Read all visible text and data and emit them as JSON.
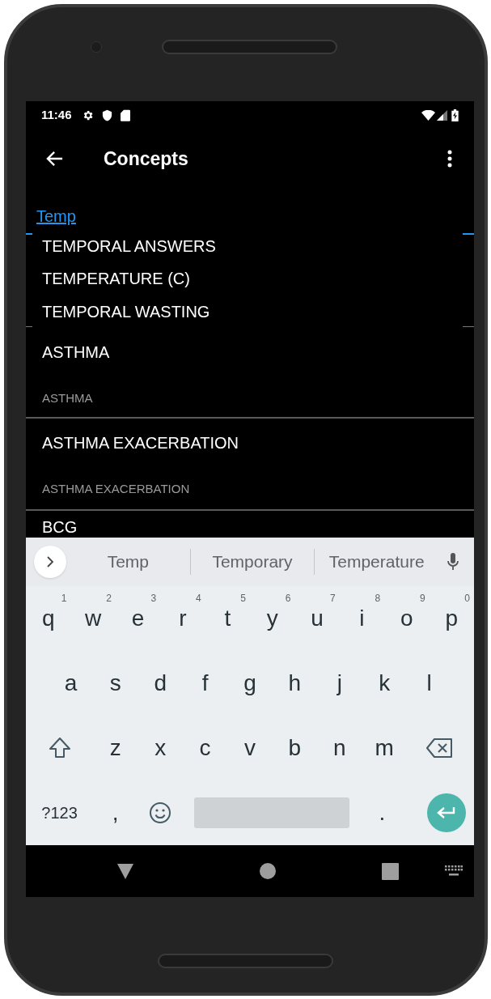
{
  "status_bar": {
    "time": "11:46"
  },
  "app_bar": {
    "title": "Concepts"
  },
  "search": {
    "value": "Temp"
  },
  "autocomplete": [
    "TEMPORAL ANSWERS",
    "TEMPERATURE (C)",
    "TEMPORAL WASTING"
  ],
  "concepts": [
    {
      "name": "ASTHMA",
      "description": "ASTHMA"
    },
    {
      "name": "ASTHMA EXACERBATION",
      "description": "ASTHMA EXACERBATION"
    },
    {
      "name": "BCG"
    }
  ],
  "keyboard": {
    "suggestions": [
      "Temp",
      "Temporary",
      "Temperature"
    ],
    "rows": [
      {
        "keys": [
          {
            "kind": "letter",
            "label": "q",
            "hint": "1"
          },
          {
            "kind": "letter",
            "label": "w",
            "hint": "2"
          },
          {
            "kind": "letter",
            "label": "e",
            "hint": "3"
          },
          {
            "kind": "letter",
            "label": "r",
            "hint": "4"
          },
          {
            "kind": "letter",
            "label": "t",
            "hint": "5"
          },
          {
            "kind": "letter",
            "label": "y",
            "hint": "6"
          },
          {
            "kind": "letter",
            "label": "u",
            "hint": "7"
          },
          {
            "kind": "letter",
            "label": "i",
            "hint": "8"
          },
          {
            "kind": "letter",
            "label": "o",
            "hint": "9"
          },
          {
            "kind": "letter",
            "label": "p",
            "hint": "0"
          }
        ]
      },
      {
        "keys": [
          {
            "kind": "letter",
            "label": "a"
          },
          {
            "kind": "letter",
            "label": "s"
          },
          {
            "kind": "letter",
            "label": "d"
          },
          {
            "kind": "letter",
            "label": "f"
          },
          {
            "kind": "letter",
            "label": "g"
          },
          {
            "kind": "letter",
            "label": "h"
          },
          {
            "kind": "letter",
            "label": "j"
          },
          {
            "kind": "letter",
            "label": "k"
          },
          {
            "kind": "letter",
            "label": "l"
          }
        ]
      },
      {
        "keys": [
          {
            "kind": "shift"
          },
          {
            "kind": "letter",
            "label": "z"
          },
          {
            "kind": "letter",
            "label": "x"
          },
          {
            "kind": "letter",
            "label": "c"
          },
          {
            "kind": "letter",
            "label": "v"
          },
          {
            "kind": "letter",
            "label": "b"
          },
          {
            "kind": "letter",
            "label": "n"
          },
          {
            "kind": "letter",
            "label": "m"
          },
          {
            "kind": "backspace"
          }
        ]
      },
      {
        "keys": [
          {
            "kind": "symbols",
            "label": "?123"
          },
          {
            "kind": "letter",
            "label": ","
          },
          {
            "kind": "emoji"
          },
          {
            "kind": "space"
          },
          {
            "kind": "letter",
            "label": "."
          },
          {
            "kind": "enter"
          }
        ]
      }
    ]
  }
}
